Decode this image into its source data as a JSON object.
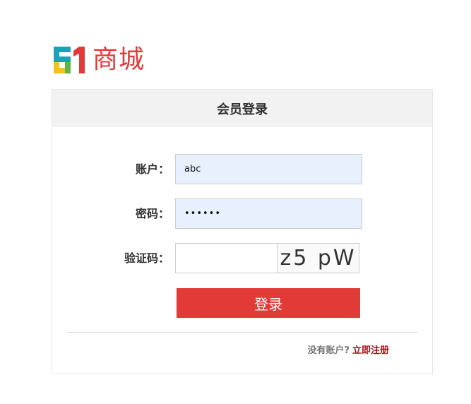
{
  "logo": {
    "mark_text": "51",
    "text": "商城",
    "colors": {
      "accent": "#e2393b",
      "mark_teal": "#1aa2b8",
      "mark_yellow": "#f4c21c",
      "mark_green": "#5fb443"
    }
  },
  "panel": {
    "title": "会员登录"
  },
  "form": {
    "account": {
      "label": "账户：",
      "value": "abc"
    },
    "password": {
      "label": "密码：",
      "value": "••••••"
    },
    "captcha": {
      "label": "验证码：",
      "value": "",
      "image_text": "z5 pW"
    },
    "submit_label": "登录"
  },
  "footer": {
    "hint": "没有账户?",
    "register_label": "立即注册"
  },
  "colors": {
    "brand_red": "#e23a37",
    "link_red": "#a2161a",
    "header_bg": "#f2f2f2",
    "autofill_bg": "#e8f0fe"
  }
}
